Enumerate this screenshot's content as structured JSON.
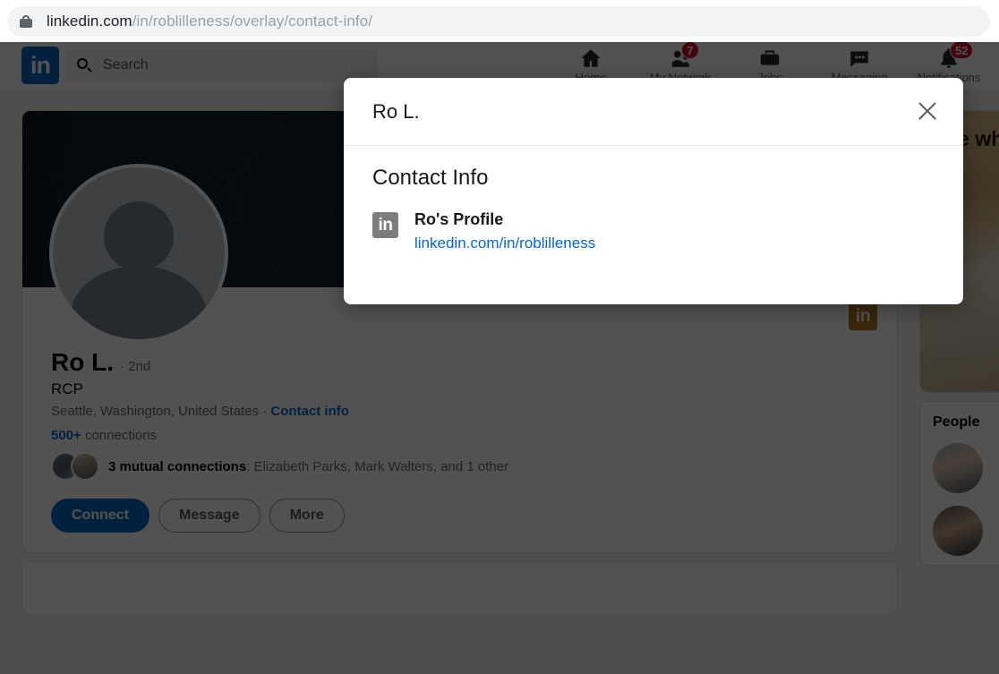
{
  "browser": {
    "lock_icon": "lock-icon",
    "url_host": "linkedin.com",
    "url_path": "/in/roblilleness/overlay/contact-info/"
  },
  "nav": {
    "logo_text": "in",
    "search": {
      "icon": "search-icon",
      "placeholder": "Search",
      "value": ""
    },
    "items": [
      {
        "icon": "home-icon",
        "label": "Home",
        "badge": ""
      },
      {
        "icon": "my-network-icon",
        "label": "My Network",
        "badge": "7"
      },
      {
        "icon": "jobs-icon",
        "label": "Jobs",
        "badge": ""
      },
      {
        "icon": "messaging-icon",
        "label": "Messaging",
        "badge": ""
      },
      {
        "icon": "notifications-icon",
        "label": "Notifications",
        "badge": "52"
      }
    ]
  },
  "profile": {
    "cover_alt": "city-network-cover-photo",
    "avatar_alt": "default-profile-photo",
    "corner_badge": "in",
    "name": "Ro L.",
    "degree": "· 2nd",
    "headline": "RCP",
    "location": "Seattle, Washington, United States ·",
    "contact_info_link": "Contact info",
    "connections": "500+",
    "connections_suffix": " connections",
    "mutual_prefix": "3 mutual connections",
    "mutual_rest": ": Elizabeth Parks, Mark Walters, and 1 other",
    "buttons": {
      "connect": "Connect",
      "message": "Message",
      "more": "More"
    }
  },
  "sidebar": {
    "ad": {
      "headline": "See who's\non L...",
      "sub": ""
    },
    "people_title": "People",
    "people": [
      {
        "avatar": "person-avatar-1"
      },
      {
        "avatar": "person-avatar-2"
      }
    ]
  },
  "modal": {
    "title": "Ro L.",
    "close_icon": "close-icon",
    "section_title": "Contact Info",
    "entry": {
      "icon": "linkedin-icon",
      "label": "Ro's Profile",
      "link": "linkedin.com/in/roblilleness"
    }
  },
  "colors": {
    "accent": "#0a66c2",
    "badge": "#cb112d",
    "page_bg": "#f3f2ef"
  }
}
